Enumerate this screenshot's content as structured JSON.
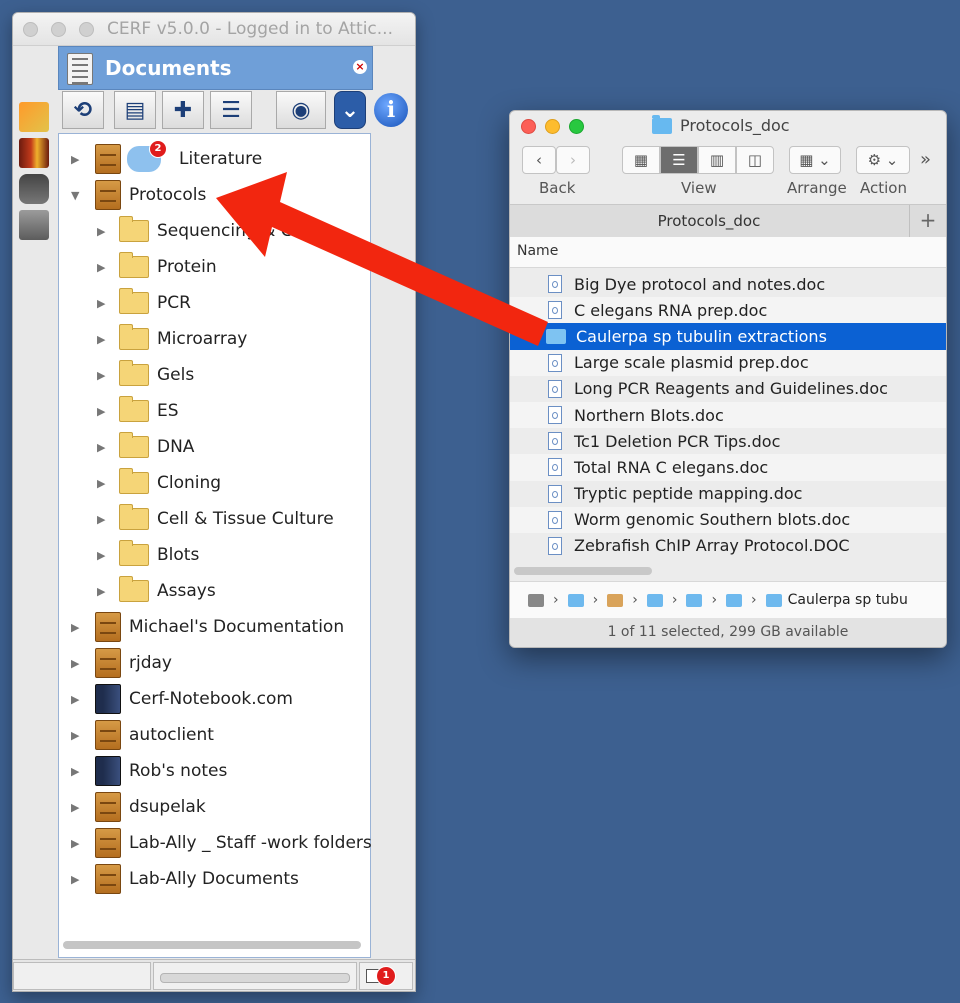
{
  "cerf": {
    "window_title": "CERF v5.0.0 - Logged in to Attic...",
    "panel_title": "Documents",
    "tree": [
      {
        "label": "Literature",
        "kind": "cabinet",
        "badge": "2",
        "expanded": false
      },
      {
        "label": "Protocols",
        "kind": "cabinet",
        "expanded": true
      },
      {
        "label": "Sequencing & ChIP",
        "kind": "folder"
      },
      {
        "label": "Protein",
        "kind": "folder"
      },
      {
        "label": "PCR",
        "kind": "folder"
      },
      {
        "label": "Microarray",
        "kind": "folder"
      },
      {
        "label": "Gels",
        "kind": "folder"
      },
      {
        "label": "ES",
        "kind": "folder"
      },
      {
        "label": "DNA",
        "kind": "folder"
      },
      {
        "label": "Cloning",
        "kind": "folder"
      },
      {
        "label": "Cell & Tissue Culture",
        "kind": "folder"
      },
      {
        "label": "Blots",
        "kind": "folder"
      },
      {
        "label": "Assays",
        "kind": "folder"
      },
      {
        "label": "Michael's Documentation",
        "kind": "cabinet"
      },
      {
        "label": "rjday",
        "kind": "cabinet"
      },
      {
        "label": "Cerf-Notebook.com",
        "kind": "book"
      },
      {
        "label": "autoclient",
        "kind": "cabinet"
      },
      {
        "label": "Rob's notes",
        "kind": "book"
      },
      {
        "label": "dsupelak",
        "kind": "cabinet"
      },
      {
        "label": "Lab-Ally _ Staff -work folders",
        "kind": "cabinet"
      },
      {
        "label": "Lab-Ally Documents",
        "kind": "cabinet"
      }
    ],
    "status_badge": "1",
    "icons": [
      "import-icon",
      "books-icon",
      "binoculars-icon",
      "drive-icon",
      "refresh-icon",
      "new-document-icon",
      "add-icon",
      "document-list-icon",
      "eye-icon",
      "expand-down-icon",
      "info-icon"
    ]
  },
  "finder": {
    "window_title": "Protocols_doc",
    "toolbar": {
      "back_label": "Back",
      "view_label": "View",
      "arrange_label": "Arrange",
      "action_label": "Action"
    },
    "path_tab": "Protocols_doc",
    "column_header": "Name",
    "files": [
      {
        "name": "Big Dye protocol and notes.doc",
        "type": "doc"
      },
      {
        "name": "C elegans RNA prep.doc",
        "type": "doc"
      },
      {
        "name": "Caulerpa sp tubulin extractions",
        "type": "folder",
        "selected": true
      },
      {
        "name": "Large scale plasmid prep.doc",
        "type": "doc"
      },
      {
        "name": "Long PCR Reagents and Guidelines.doc",
        "type": "doc"
      },
      {
        "name": "Northern Blots.doc",
        "type": "doc"
      },
      {
        "name": "Tc1 Deletion PCR Tips.doc",
        "type": "doc"
      },
      {
        "name": "Total RNA C elegans.doc",
        "type": "doc"
      },
      {
        "name": "Tryptic peptide mapping.doc",
        "type": "doc"
      },
      {
        "name": "Worm genomic Southern blots.doc",
        "type": "doc"
      },
      {
        "name": "Zebrafish ChIP Array Protocol.DOC",
        "type": "doc"
      }
    ],
    "path_last": "Caulerpa sp tubu",
    "status": "1 of 11 selected, 299 GB available"
  },
  "colors": {
    "accent_blue": "#0b61d3",
    "desktop": "#3d6090",
    "arrow_red": "#f2260f",
    "panel_blue": "#6f9fd8"
  }
}
